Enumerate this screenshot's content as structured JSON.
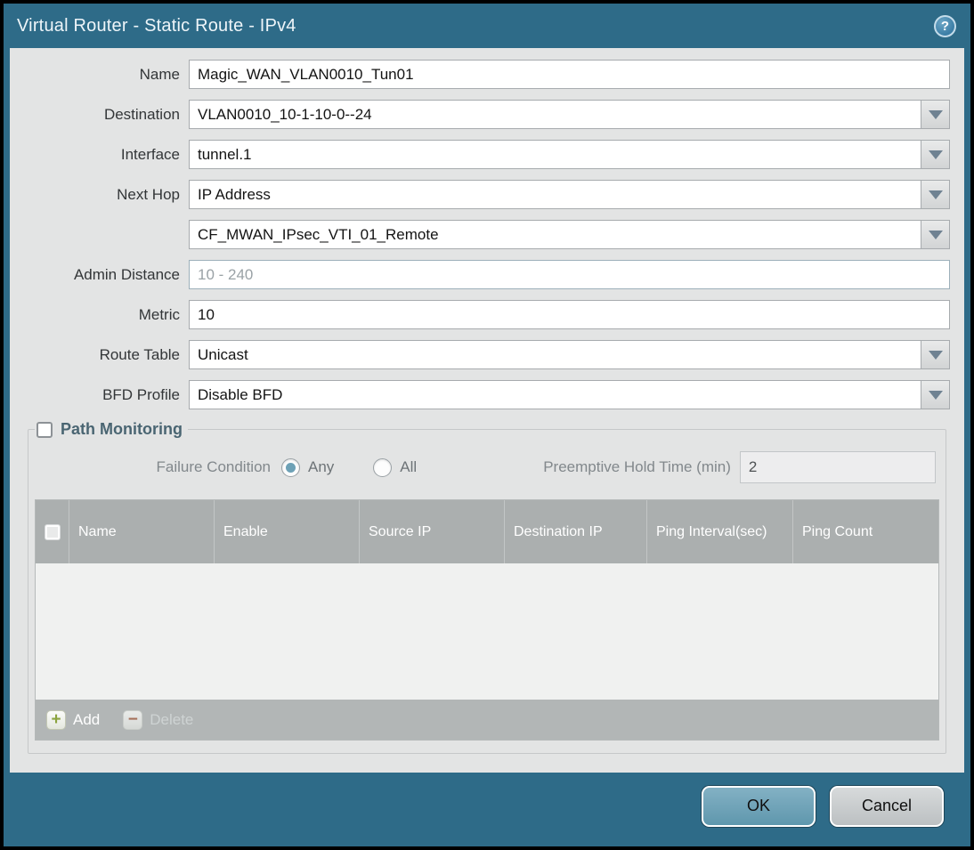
{
  "window": {
    "title": "Virtual Router - Static Route - IPv4"
  },
  "icons": {
    "help": "?",
    "add": "+",
    "delete": "−"
  },
  "form": {
    "name": {
      "label": "Name",
      "value": "Magic_WAN_VLAN0010_Tun01"
    },
    "destination": {
      "label": "Destination",
      "value": "VLAN0010_10-1-10-0--24"
    },
    "interface": {
      "label": "Interface",
      "value": "tunnel.1"
    },
    "next_hop": {
      "label": "Next Hop",
      "value": "IP Address"
    },
    "next_hop_address": {
      "value": "CF_MWAN_IPsec_VTI_01_Remote"
    },
    "admin_distance": {
      "label": "Admin Distance",
      "placeholder": "10 - 240"
    },
    "metric": {
      "label": "Metric",
      "value": "10"
    },
    "route_table": {
      "label": "Route Table",
      "value": "Unicast"
    },
    "bfd_profile": {
      "label": "BFD Profile",
      "value": "Disable BFD"
    }
  },
  "path_monitoring": {
    "title": "Path Monitoring",
    "enabled": false,
    "failure_condition": {
      "label": "Failure Condition",
      "options": [
        {
          "label": "Any",
          "selected": true
        },
        {
          "label": "All",
          "selected": false
        }
      ]
    },
    "preemptive_hold_time": {
      "label": "Preemptive Hold Time (min)",
      "value": "2"
    },
    "table": {
      "columns": [
        "Name",
        "Enable",
        "Source IP",
        "Destination IP",
        "Ping Interval(sec)",
        "Ping Count"
      ],
      "rows": []
    },
    "toolbar": {
      "add_label": "Add",
      "delete_label": "Delete",
      "delete_disabled": true
    }
  },
  "footer": {
    "ok_label": "OK",
    "cancel_label": "Cancel"
  },
  "colors": {
    "titlebar": "#2e6b88",
    "panel": "#e3e4e4",
    "ok_button": "#6fa3b9",
    "table_header": "#abafaf",
    "add_icon": "#8ba43e",
    "delete_icon": "#a5705a"
  }
}
